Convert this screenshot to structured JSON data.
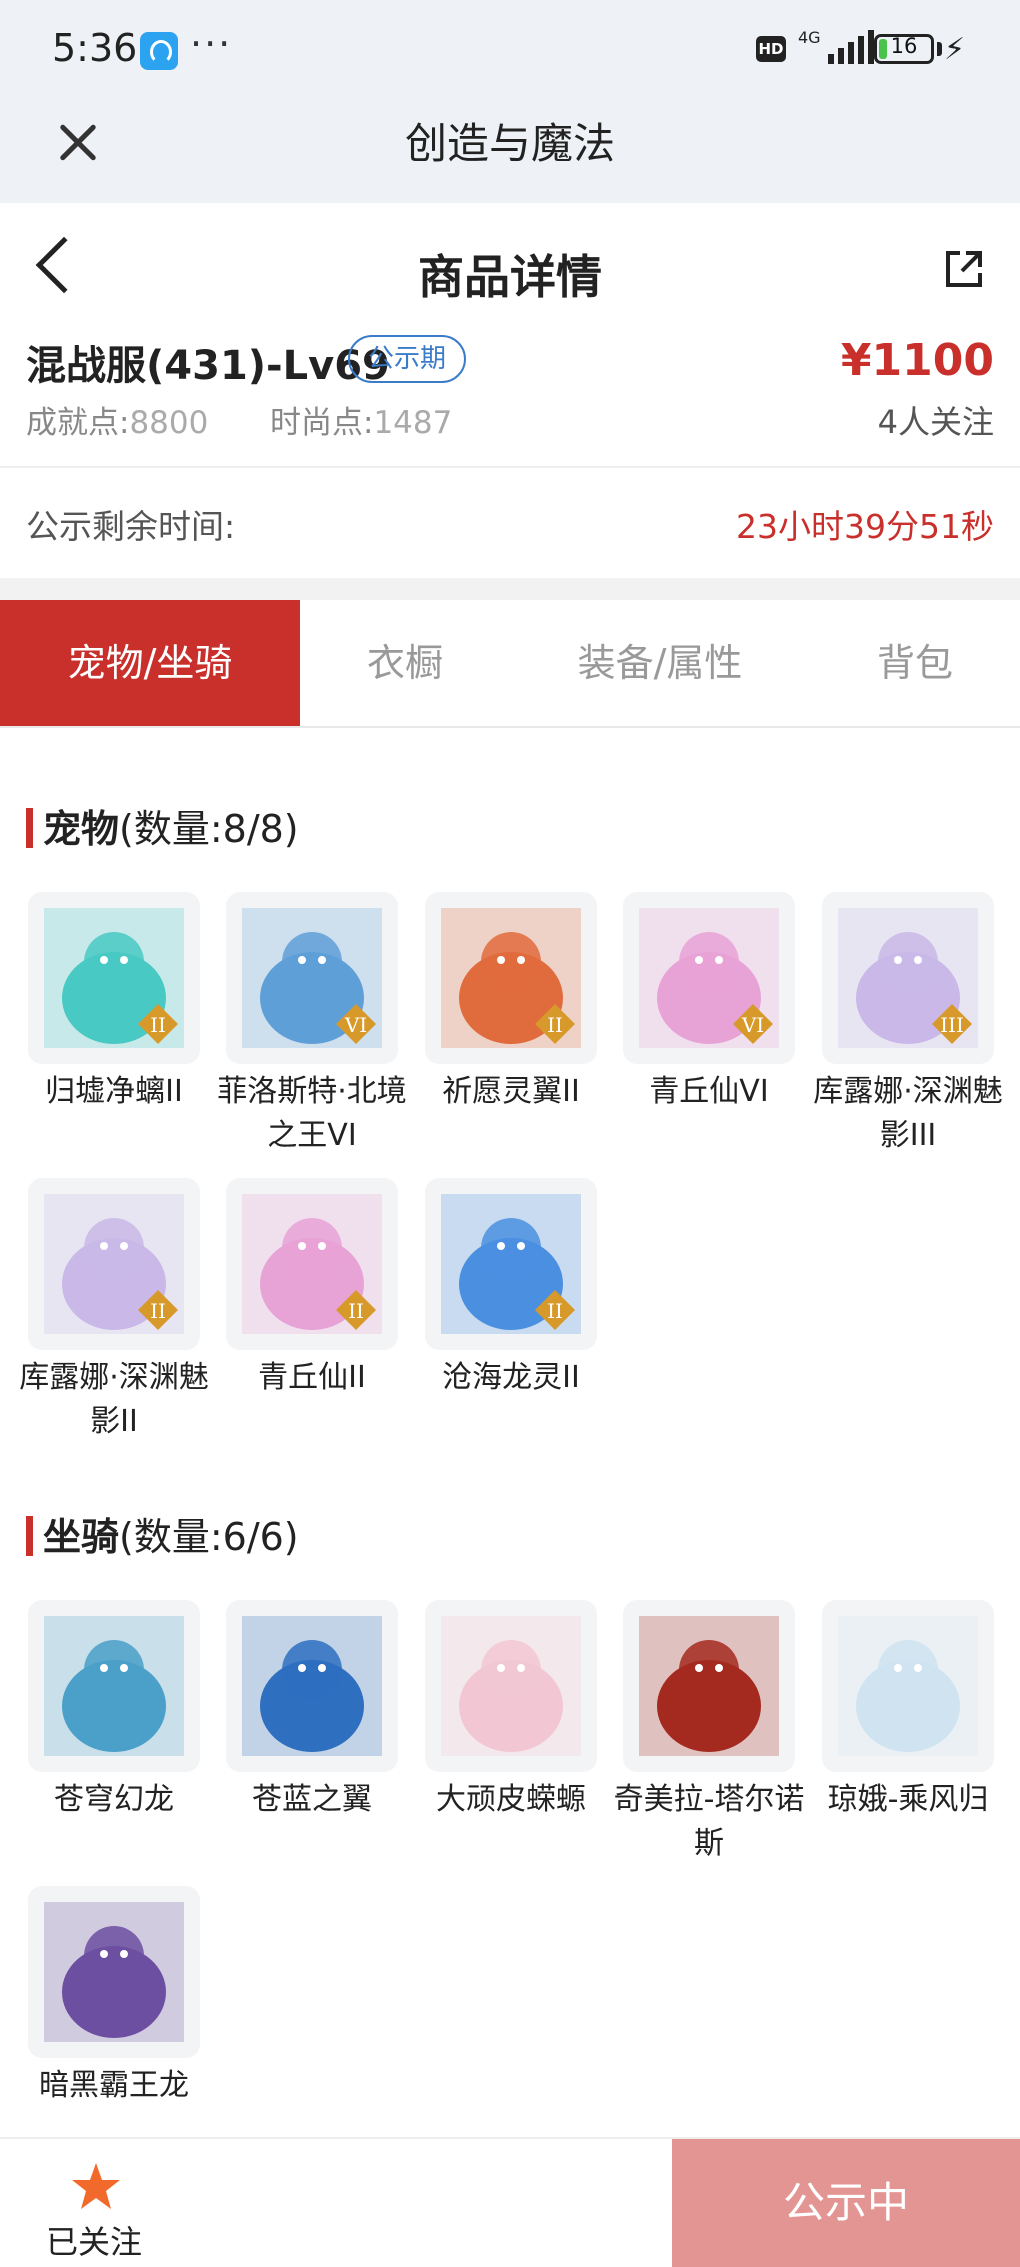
{
  "status_bar": {
    "time": "5:36",
    "more": "···",
    "hd": "HD",
    "network": "4G",
    "battery": "16",
    "battery_level": 0.16,
    "icons": [
      "app-icon",
      "hd-icon",
      "signal-icon",
      "battery-icon",
      "charging-icon"
    ]
  },
  "title_bar": {
    "title": "创造与魔法",
    "close_icon": "close-icon"
  },
  "nav": {
    "title": "商品详情",
    "back_icon": "back-icon",
    "share_icon": "share-icon"
  },
  "product": {
    "server": "混战服(431)-Lv69",
    "badge": "公示期",
    "price": "¥1100",
    "achievement_label": "成就点:",
    "achievement_value": "8800",
    "fashion_label": "时尚点:",
    "fashion_value": "1487",
    "followers": "4人关注"
  },
  "timer": {
    "label": "公示剩余时间:",
    "value": "23小时39分51秒"
  },
  "tabs": [
    {
      "label": "宠物/坐骑",
      "active": true
    },
    {
      "label": "衣橱",
      "active": false
    },
    {
      "label": "装备/属性",
      "active": false
    },
    {
      "label": "背包",
      "active": false
    }
  ],
  "pets": {
    "title": "宠物",
    "count": "(数量:8/8)",
    "items": [
      {
        "name": "归墟净螭II",
        "color": "#49c9c4",
        "rank": "II"
      },
      {
        "name": "菲洛斯特·北境之王VI",
        "color": "#5f9fd8",
        "rank": "VI"
      },
      {
        "name": "祈愿灵翼II",
        "color": "#e06b3c",
        "rank": "II"
      },
      {
        "name": "青丘仙VI",
        "color": "#e7a2d6",
        "rank": "VI"
      },
      {
        "name": "库露娜·深渊魅影III",
        "color": "#c9b8e8",
        "rank": "III"
      },
      {
        "name": "库露娜·深渊魅影II",
        "color": "#c9b8e8",
        "rank": "II"
      },
      {
        "name": "青丘仙II",
        "color": "#e7a2d6",
        "rank": "II"
      },
      {
        "name": "沧海龙灵II",
        "color": "#4a8fe0",
        "rank": "II"
      }
    ]
  },
  "mounts": {
    "title": "坐骑",
    "count": "(数量:6/6)",
    "items": [
      {
        "name": "苍穹幻龙",
        "color": "#4aa0c8"
      },
      {
        "name": "苍蓝之翼",
        "color": "#2e6fbf"
      },
      {
        "name": "大顽皮蝾螈",
        "color": "#f2c7d3"
      },
      {
        "name": "奇美拉-塔尔诺斯",
        "color": "#a42a20"
      },
      {
        "name": "琼娥-乘风归",
        "color": "#cfe3f0"
      },
      {
        "name": "暗黑霸王龙",
        "color": "#6c4fa0"
      }
    ]
  },
  "bottom": {
    "follow_label": "已关注",
    "action_label": "公示中",
    "star_color": "#f26a2b"
  }
}
